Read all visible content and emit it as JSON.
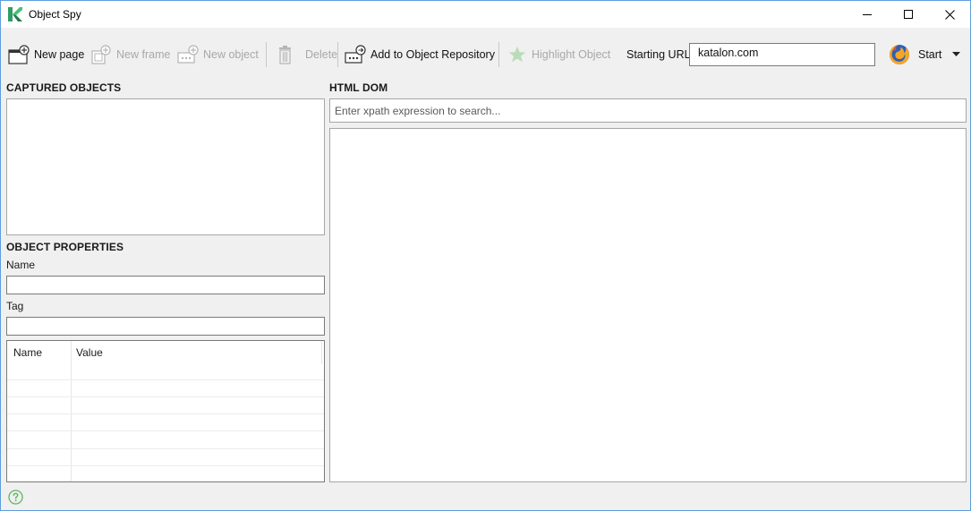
{
  "window": {
    "title": "Object Spy",
    "controls": {
      "minimize": "minimize-icon",
      "maximize": "maximize-icon",
      "close": "close-icon"
    }
  },
  "toolbar": {
    "new_page": "New page",
    "new_frame": "New frame",
    "new_object": "New object",
    "delete": "Delete",
    "add_to_repo": "Add to Object Repository",
    "highlight": "Highlight Object",
    "url_label": "Starting URL",
    "url_value": "katalon.com",
    "start": "Start"
  },
  "captured": {
    "title": "CAPTURED OBJECTS"
  },
  "properties": {
    "title": "OBJECT PROPERTIES",
    "name_label": "Name",
    "name_value": "",
    "tag_label": "Tag",
    "tag_value": "",
    "table": {
      "columns": [
        "Name",
        "Value"
      ],
      "rows": []
    }
  },
  "dom": {
    "title": "HTML DOM",
    "search_placeholder": "Enter xpath expression to search..."
  },
  "colors": {
    "accent": "#5f9edc",
    "brand_green": "#3db26f",
    "disabled_text": "#a8a8a8",
    "help_green": "#5cb85c"
  }
}
